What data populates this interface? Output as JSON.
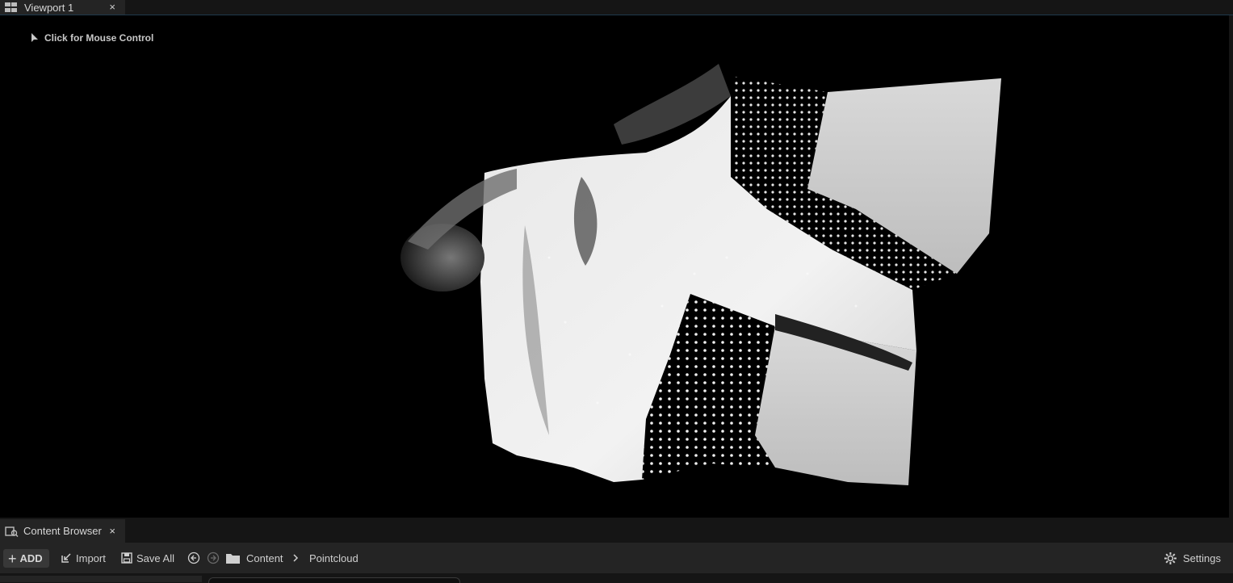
{
  "viewport_tab": {
    "label": "Viewport 1",
    "close": "×"
  },
  "viewport": {
    "mouse_hint": "Click for Mouse Control"
  },
  "content_browser": {
    "tab_label": "Content Browser",
    "close": "×",
    "toolbar": {
      "add_label": "ADD",
      "import_label": "Import",
      "save_all_label": "Save All",
      "breadcrumb": [
        "Content",
        "Pointcloud"
      ],
      "settings_label": "Settings"
    }
  },
  "icons": {
    "viewport_tab": "layout-grid-icon",
    "mouse": "cursor-icon",
    "content_browser": "content-browser-icon",
    "add": "plus-icon",
    "import": "import-icon",
    "save_all": "save-icon",
    "back": "back-arrow-icon",
    "forward": "forward-arrow-icon",
    "folder": "folder-icon",
    "chevron": "chevron-right-icon",
    "settings": "gear-icon"
  },
  "colors": {
    "background": "#151515",
    "panel": "#242424",
    "viewport": "#000000",
    "text": "#c8c8c8"
  }
}
